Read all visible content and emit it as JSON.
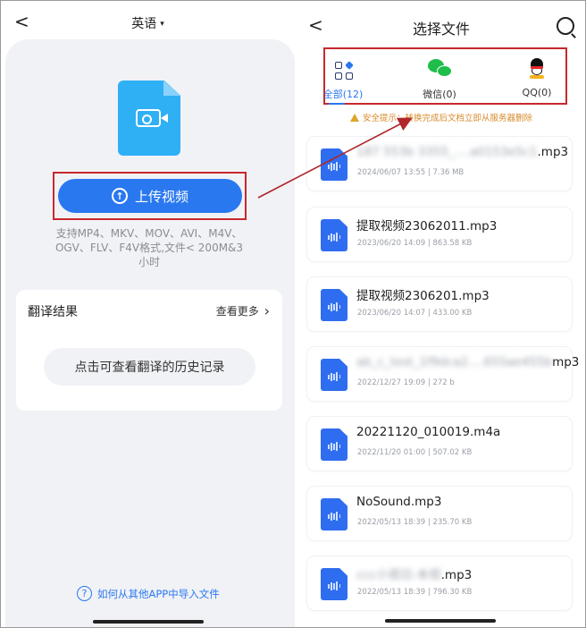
{
  "left": {
    "back_icon": "back-chevron-icon",
    "language": "英语",
    "language_caret": "▾",
    "upload_button": "上传视频",
    "formats_text": "支持MP4、MKV、MOV、AVI、M4V、OGV、FLV、F4V格式,文件< 200M&3小时",
    "results_title": "翻译结果",
    "more_label": "查看更多",
    "more_chevron": "›",
    "history_button": "点击可查看翻译的历史记录",
    "help_link": "如何从其他APP中导入文件",
    "help_icon_glyph": "?"
  },
  "right": {
    "title": "选择文件",
    "tabs": [
      {
        "label": "全部(12)",
        "icon": "grid-icon",
        "active": true
      },
      {
        "label": "微信(0)",
        "icon": "wechat-icon",
        "active": false
      },
      {
        "label": "QQ(0)",
        "icon": "qq-icon",
        "active": false
      }
    ],
    "notice": "安全提示：转换完成后文档立即从服务器删除",
    "files": [
      {
        "name": "187 553b 3355_....a0153e5c1",
        "ext": ".mp3",
        "meta": "2024/06/07 13:55  |  7.36 MB",
        "blurred": true
      },
      {
        "name": "提取视频23062011.mp3",
        "ext": "",
        "meta": "2023/06/20 14:09  |  863.58 KB",
        "blurred": false
      },
      {
        "name": "提取视频2306201.mp3",
        "ext": "",
        "meta": "2023/06/20 14:07  |  433.00 KB",
        "blurred": false
      },
      {
        "name": "ab_c_test_1f9dca2....655ae455b",
        "ext": "mp3",
        "meta": "2022/12/27 19:09  |  272 b",
        "blurred": true
      },
      {
        "name": "20221120_010019.m4a",
        "ext": "",
        "meta": "2022/11/20 01:00  |  507.02 KB",
        "blurred": false
      },
      {
        "name": "NoSound.mp3",
        "ext": "",
        "meta": "2022/05/13 18:39  |  235.70 KB",
        "blurred": false
      },
      {
        "name": "ccc小视日-本视",
        "ext": ".mp3",
        "meta": "2022/05/13 18:39  |  796.30 KB",
        "blurred": true
      }
    ]
  },
  "colors": {
    "accent": "#2a78f0",
    "highlight_box": "#c7282d",
    "doc_icon": "#2fb0f5",
    "audio_file_icon": "#2f6df0",
    "notice": "#d88a2b"
  }
}
